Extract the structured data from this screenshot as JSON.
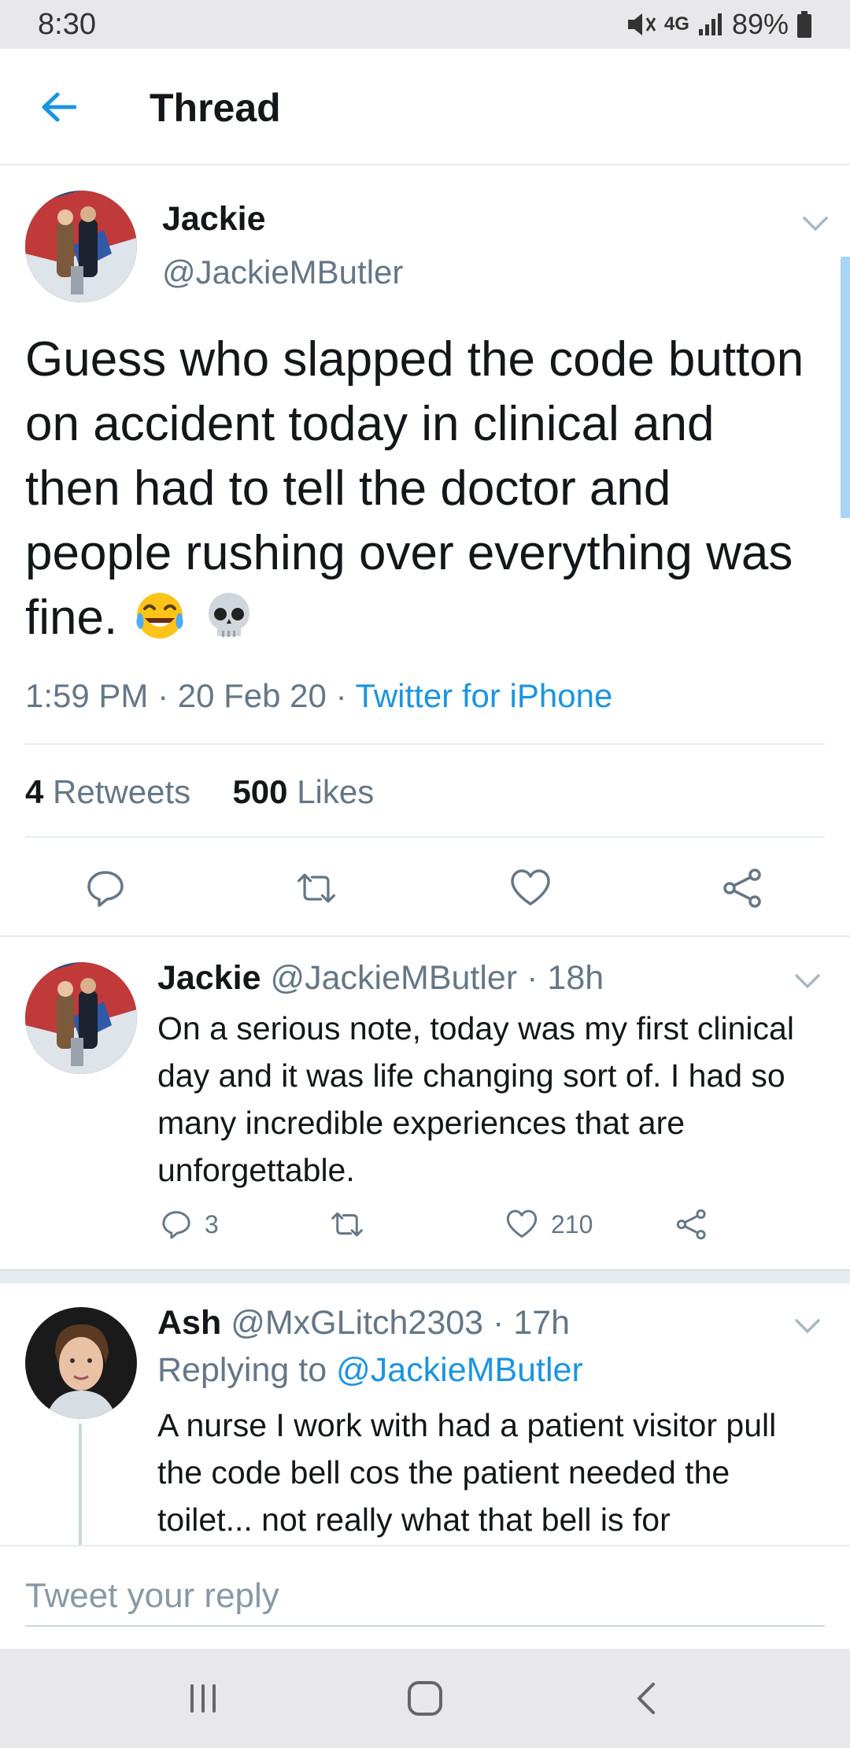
{
  "status_bar": {
    "time": "8:30",
    "network": "4G",
    "battery": "89%"
  },
  "header": {
    "title": "Thread"
  },
  "main_tweet": {
    "name": "Jackie",
    "handle": "@JackieMButler",
    "text": "Guess who slapped the code button on accident today in clinical and then had to tell the doctor and people rushing over everything was fine.",
    "emojis": [
      "tears-of-joy-emoji",
      "skull-emoji"
    ],
    "time": "1:59 PM",
    "date": "20 Feb 20",
    "source": "Twitter for iPhone",
    "retweets_count": "4",
    "retweets_label": "Retweets",
    "likes_count": "500",
    "likes_label": "Likes"
  },
  "replies": [
    {
      "name": "Jackie",
      "handle": "@JackieMButler",
      "age": "18h",
      "text": "On a serious note, today was my first clinical day and it was life changing sort of. I had so many incredible experiences that are unforgettable.",
      "reply_count": "3",
      "like_count": "210"
    },
    {
      "name": "Ash",
      "handle": "@MxGLitch2303",
      "age": "17h",
      "replying_label": "Replying to",
      "replying_to": "@JackieMButler",
      "text": "A nurse I work with had a patient visitor pull the code bell cos the patient needed the toilet... not really what that bell is for"
    }
  ],
  "composer": {
    "placeholder": "Tweet your reply"
  },
  "colors": {
    "accent": "#1b95e0",
    "secondary_text": "#657786",
    "primary_text": "#14171a",
    "divider": "#e6ecf0"
  }
}
